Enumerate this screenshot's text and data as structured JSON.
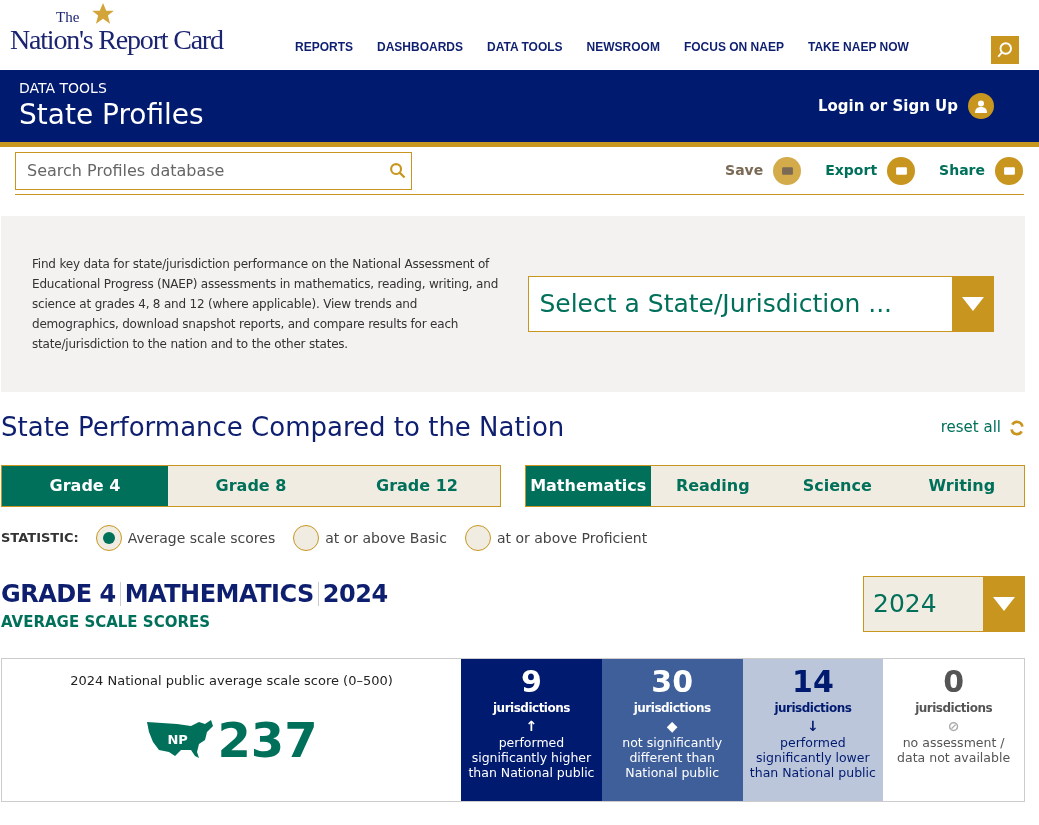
{
  "logo": {
    "small": "The",
    "main": "Nation's Report Card"
  },
  "nav": [
    "REPORTS",
    "DASHBOARDS",
    "DATA TOOLS",
    "NEWSROOM",
    "FOCUS ON NAEP",
    "TAKE NAEP NOW"
  ],
  "banner": {
    "eyebrow": "DATA TOOLS",
    "title": "State Profiles",
    "login": "Login or Sign Up"
  },
  "search": {
    "placeholder": "Search Profiles database"
  },
  "actions": [
    {
      "label": "Save",
      "disabled": true
    },
    {
      "label": "Export",
      "disabled": false
    },
    {
      "label": "Share",
      "disabled": false
    }
  ],
  "intro": {
    "text": "Find key data for state/jurisdiction performance on the National Assessment of Educational Progress (NAEP) assessments in mathematics, reading, writing, and science at grades 4, 8 and 12 (where applicable). View trends and demographics, download snapshot reports, and compare results for each state/jurisdiction to the nation and to the other states.",
    "select": "Select a State/Jurisdiction ..."
  },
  "section": {
    "title": "State Performance Compared to the Nation",
    "reset": "reset all"
  },
  "grade_tabs": [
    {
      "label": "Grade 4",
      "selected": true
    },
    {
      "label": "Grade 8",
      "selected": false
    },
    {
      "label": "Grade 12",
      "selected": false
    }
  ],
  "subject_tabs": [
    {
      "label": "Mathematics",
      "selected": true
    },
    {
      "label": "Reading",
      "selected": false
    },
    {
      "label": "Science",
      "selected": false
    },
    {
      "label": "Writing",
      "selected": false
    }
  ],
  "statistic": {
    "label": "STATISTIC:",
    "options": [
      {
        "label": "Average scale scores",
        "selected": true
      },
      {
        "label": "at or above Basic",
        "selected": false
      },
      {
        "label": "at or above Proficient",
        "selected": false
      }
    ]
  },
  "result": {
    "heading": [
      "GRADE 4",
      "MATHEMATICS",
      "2024"
    ],
    "subheading": "AVERAGE SCALE SCORES",
    "year": "2024"
  },
  "national": {
    "caption": "2024 National public average scale score (0–500)",
    "badge": "NP",
    "score": "237"
  },
  "summary": [
    {
      "kind": "higher",
      "count": "9",
      "unit": "jurisdictions",
      "glyph": "↑",
      "text": "performed significantly higher than National public"
    },
    {
      "kind": "same",
      "count": "30",
      "unit": "jurisdictions",
      "glyph": "◆",
      "text": "not significantly different than National public"
    },
    {
      "kind": "lower",
      "count": "14",
      "unit": "jurisdictions",
      "glyph": "↓",
      "text": "performed significantly lower than National public"
    },
    {
      "kind": "none",
      "count": "0",
      "unit": "jurisdictions",
      "glyph": "⊘",
      "text": "no assessment / data not available"
    }
  ]
}
